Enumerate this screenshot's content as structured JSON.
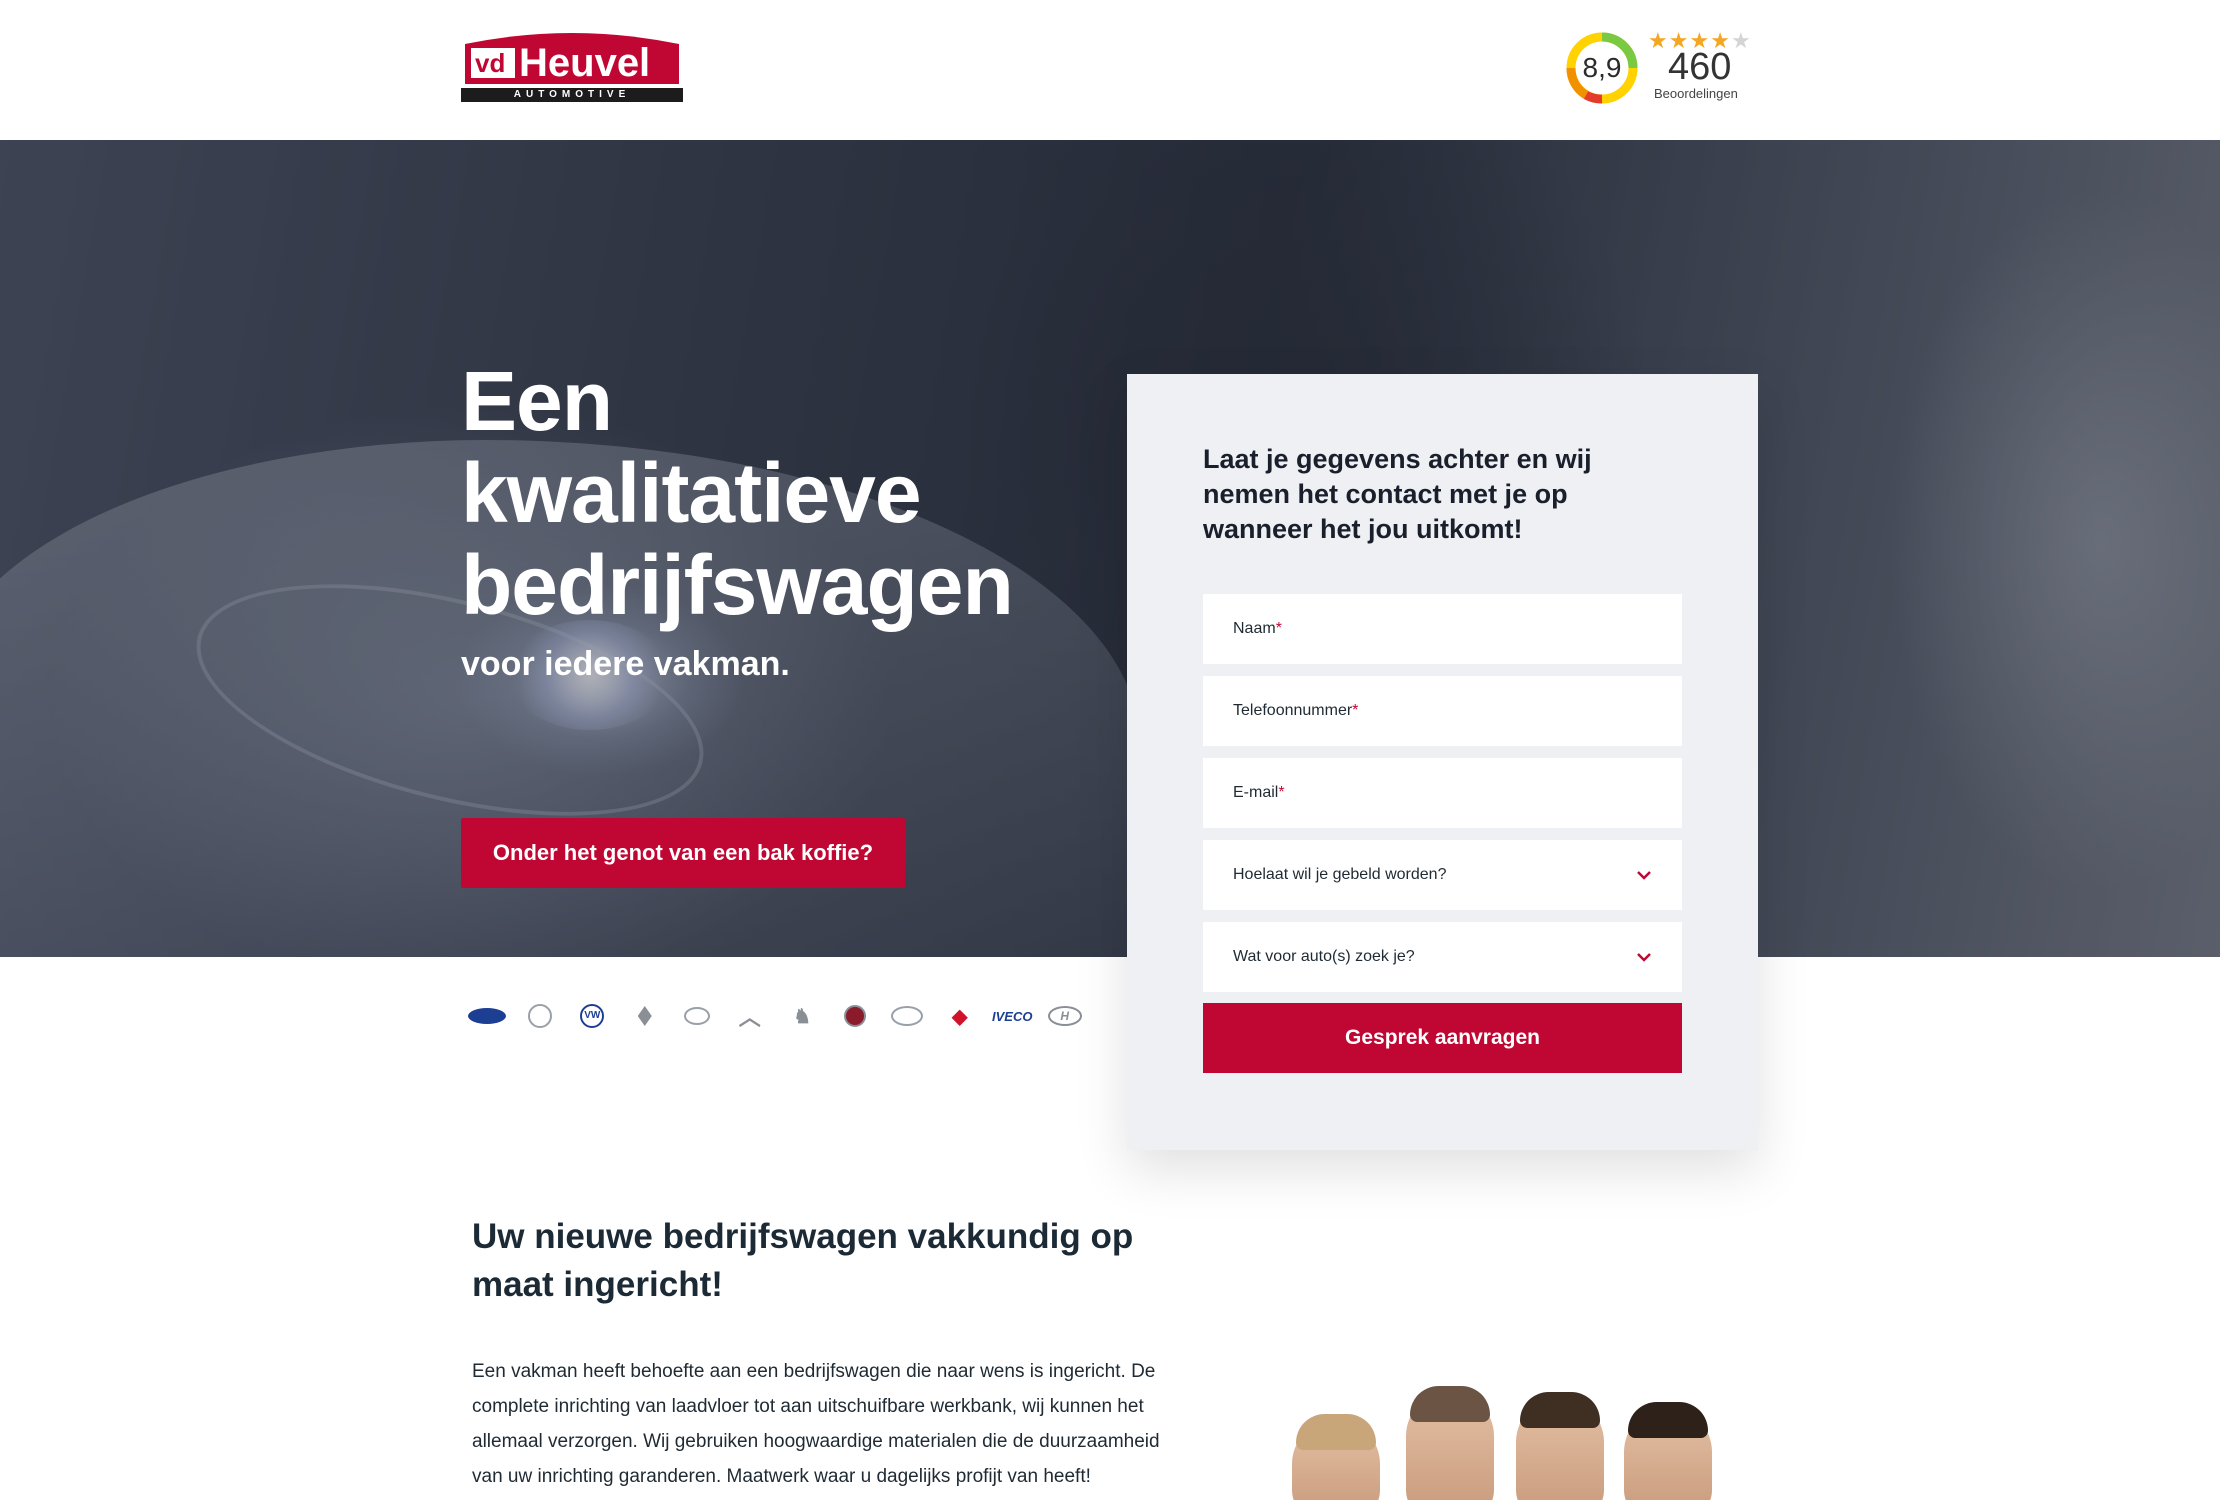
{
  "header": {
    "logo": {
      "brand_prefix": "vd",
      "brand_name": "Heuvel",
      "brand_sub": "AUTOMOTIVE"
    },
    "rating": {
      "score": "8,9",
      "stars_filled": 4,
      "stars_total": 5,
      "count": "460",
      "label": "Beoordelingen"
    }
  },
  "hero": {
    "title_line1": "Een",
    "title_line2": "kwalitatieve",
    "title_line3": "bedrijfswagen",
    "subtitle": "voor iedere vakman.",
    "cta_label": "Onder het genot van een bak koffie?"
  },
  "form": {
    "title": "Laat je gegevens achter en wij nemen het contact met je op wanneer het jou uitkomt!",
    "fields": {
      "name": {
        "placeholder": "Naam",
        "required_mark": "*"
      },
      "phone": {
        "placeholder": "Telefoonnummer",
        "required_mark": "*"
      },
      "email": {
        "placeholder": "E-mail",
        "required_mark": "*"
      },
      "call_time": {
        "placeholder": "Hoelaat wil je gebeld worden?"
      },
      "car_type": {
        "placeholder": "Wat voor auto(s) zoek je?"
      }
    },
    "submit_label": "Gesprek aanvragen"
  },
  "brands": {
    "items": [
      "ford-logo",
      "mercedes-logo",
      "volkswagen-logo",
      "renault-logo",
      "opel-logo",
      "citroen-logo",
      "peugeot-logo",
      "fiat-logo",
      "toyota-logo",
      "mitsubishi-logo",
      "iveco-logo",
      "hyundai-logo"
    ],
    "vw_mark": "VW",
    "iveco_text": "IVECO",
    "hyundai_mark": "H"
  },
  "content": {
    "title": "Uw nieuwe bedrijfswagen vakkundig op maat ingericht!",
    "text": "Een vakman heeft behoefte aan een bedrijfswagen die naar wens is ingericht. De complete inrichting van laadvloer tot aan uitschuifbare werkbank, wij kunnen het allemaal verzorgen. Wij gebruiken hoogwaardige materialen die de duurzaamheid van uw inrichting garanderen. Maatwerk waar u dagelijks profijt van heeft!"
  },
  "colors": {
    "brand_red": "#c00733",
    "dark_text": "#1c2a36",
    "form_bg": "#eef0f4",
    "star_color": "#f5a623"
  }
}
